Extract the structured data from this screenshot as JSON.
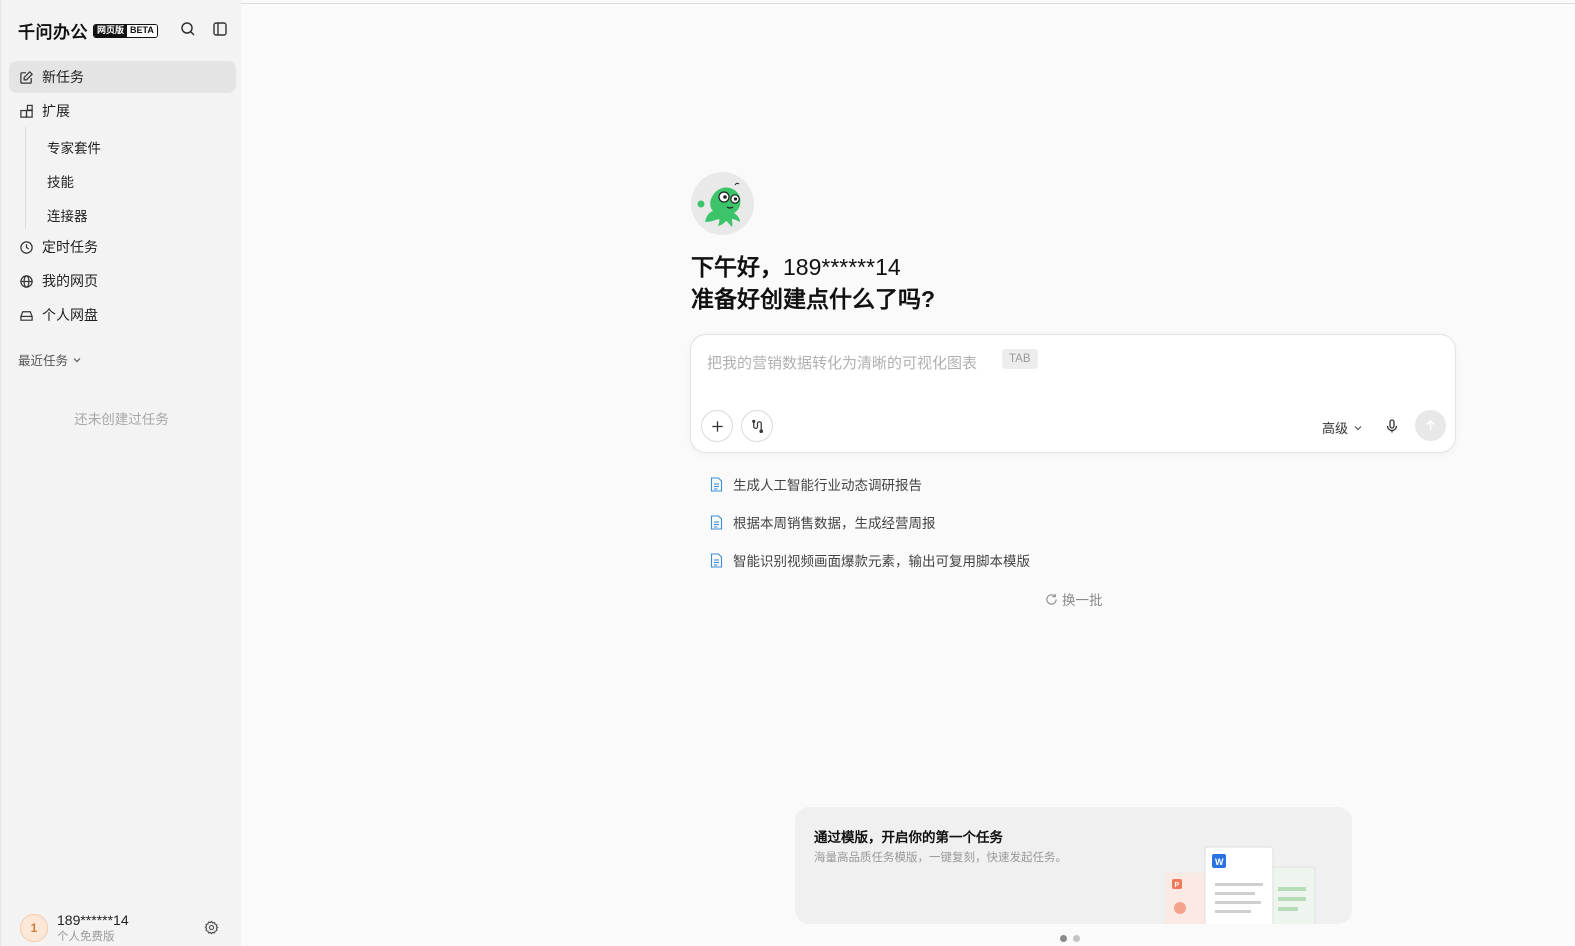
{
  "brand": {
    "name": "千问办公",
    "badge_web": "网页版",
    "badge_beta": "BETA"
  },
  "sidebar": {
    "new_task": "新任务",
    "extensions": "扩展",
    "ext_items": [
      "专家套件",
      "技能",
      "连接器"
    ],
    "scheduled": "定时任务",
    "my_web": "我的网页",
    "drive": "个人网盘",
    "recent_label": "最近任务",
    "empty": "还未创建过任务"
  },
  "user": {
    "avatar_char": "1",
    "name": "189******14",
    "plan": "个人免费版"
  },
  "main": {
    "greeting": "下午好，",
    "username": "189******14",
    "prompt": "准备好创建点什么了吗?",
    "input_placeholder": "把我的营销数据转化为清晰的可视化图表",
    "tab_hint": "TAB",
    "advanced": "高级",
    "suggestions": [
      "生成人工智能行业动态调研报告",
      "根据本周销售数据，生成经营周报",
      "智能识别视频画面爆款元素，输出可复用脚本模版"
    ],
    "refresh": "换一批",
    "card": {
      "title": "通过模版，开启你的第一个任务",
      "subtitle": "海量高品质任务模版，一键复刻，快速发起任务。",
      "doc_label": "W",
      "ppt_label": "P"
    }
  },
  "colors": {
    "mascot": "#3cc46a",
    "active_bg": "#e4e4e4",
    "doc_icon": "#3b8fd8",
    "avatar": "#d07a3c"
  }
}
